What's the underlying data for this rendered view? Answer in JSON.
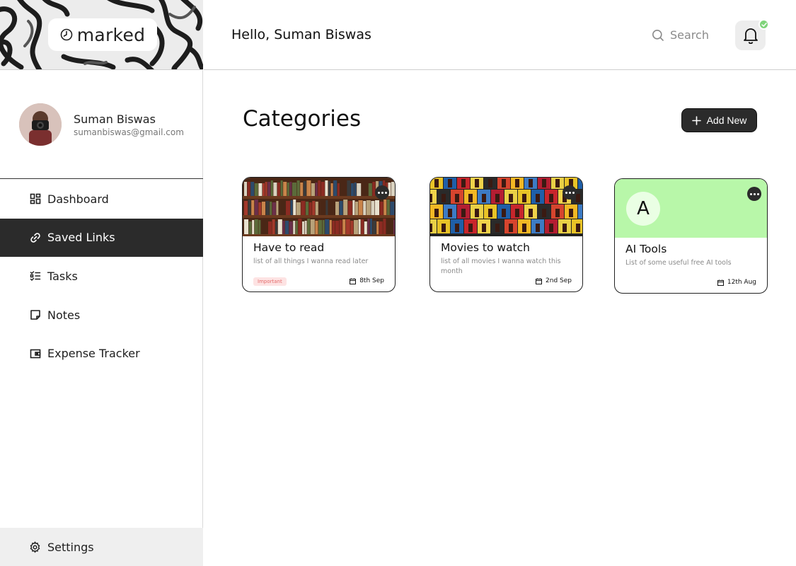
{
  "brand": {
    "name": "marked",
    "icon": "clock-logo-icon"
  },
  "profile": {
    "name": "Suman Biswas",
    "email": "sumanbiswas@gmail.com"
  },
  "nav": {
    "items": [
      {
        "label": "Dashboard",
        "icon": "grid-icon",
        "active": false
      },
      {
        "label": "Saved Links",
        "icon": "link-icon",
        "active": true
      },
      {
        "label": "Tasks",
        "icon": "checklist-icon",
        "active": false
      },
      {
        "label": "Notes",
        "icon": "note-icon",
        "active": false
      },
      {
        "label": "Expense Tracker",
        "icon": "wallet-icon",
        "active": false
      }
    ],
    "settings_label": "Settings"
  },
  "header": {
    "greeting": "Hello, Suman Biswas",
    "search_label": "Search",
    "notification_status": "check"
  },
  "main": {
    "title": "Categories",
    "add_button_label": "Add New",
    "cards": [
      {
        "title": "Have to read",
        "description": "list of all things I wanna read later",
        "tag": "Important",
        "date": "8th Sep",
        "cover": "bookshelf-image"
      },
      {
        "title": "Movies to watch",
        "description": "list of all movies I wanna watch this month",
        "tag": "",
        "date": "2nd Sep",
        "cover": "movie-posters-image"
      },
      {
        "title": "AI Tools",
        "description": "List of some useful free AI tools",
        "tag": "",
        "date": "12th Aug",
        "cover": "letter-avatar",
        "letter": "A",
        "cover_color": "#b8f7a9"
      }
    ]
  },
  "colors": {
    "accent_dark": "#2b2b2b",
    "notification_green": "#7fd47a",
    "tag_red": "#e46b6b"
  }
}
